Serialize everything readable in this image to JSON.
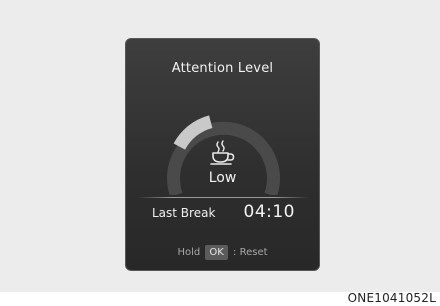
{
  "display": {
    "title": "Attention Level",
    "level_label": "Low",
    "level_fraction": 0.2,
    "last_break_label": "Last Break",
    "last_break_time": "04:10",
    "hint_prefix": "Hold",
    "hint_key": "OK",
    "hint_suffix": ": Reset",
    "icon": "coffee-cup-icon"
  },
  "figure_code": "ONE1041052L",
  "colors": {
    "gauge_fill": "#c9c9c9",
    "gauge_track": "#4a4a4a"
  }
}
